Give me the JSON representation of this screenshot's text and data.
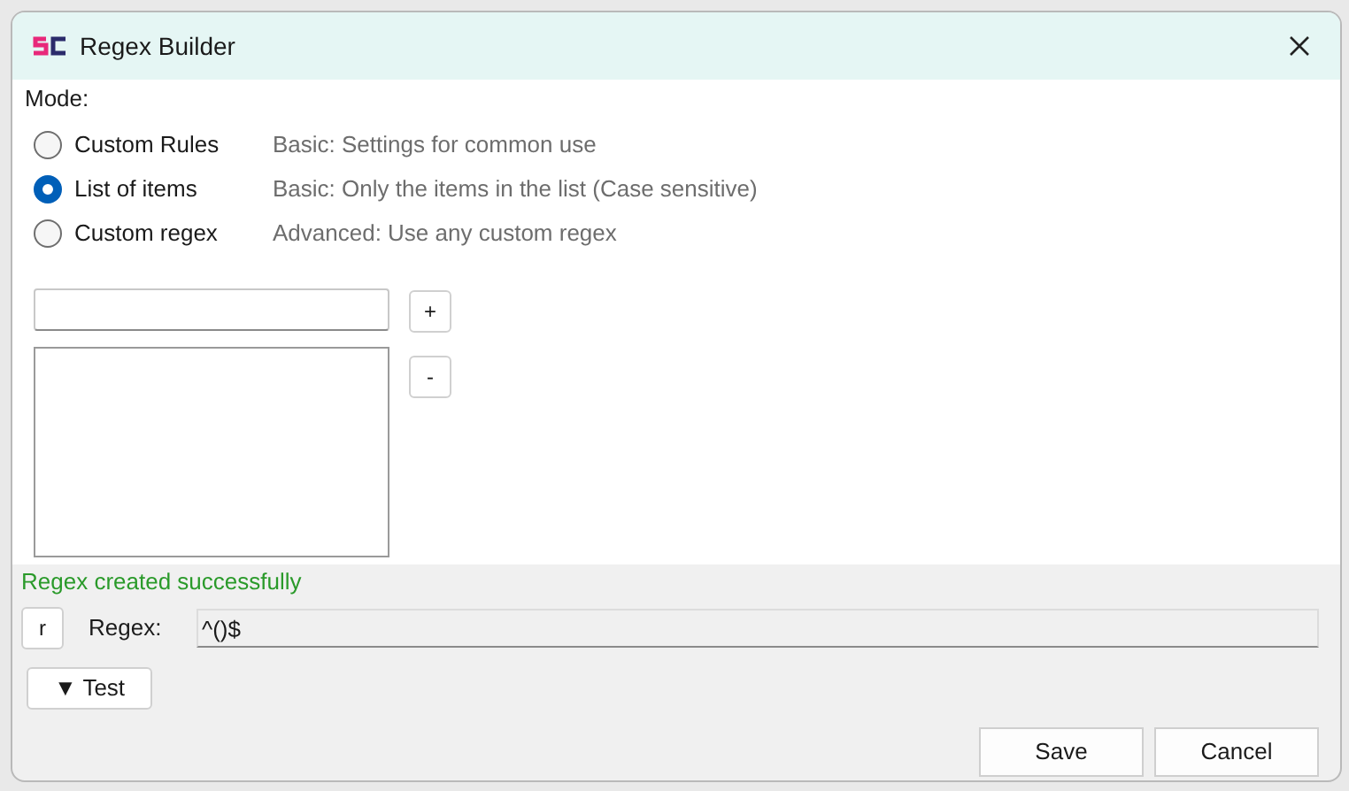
{
  "window": {
    "title": "Regex Builder"
  },
  "mode": {
    "label": "Mode:",
    "options": [
      {
        "label": "Custom Rules",
        "description": "Basic: Settings for common use",
        "selected": false
      },
      {
        "label": "List of items",
        "description": "Basic: Only the items in the list (Case sensitive)",
        "selected": true
      },
      {
        "label": "Custom regex",
        "description": "Advanced: Use any custom regex",
        "selected": false
      }
    ]
  },
  "list_editor": {
    "add_button": "+",
    "remove_button": "-"
  },
  "status": "Regex created successfully",
  "regex": {
    "button": "r",
    "label": "Regex:",
    "value": "^()$"
  },
  "test_button": "▼ Test",
  "buttons": [
    "Save",
    "Cancel"
  ]
}
